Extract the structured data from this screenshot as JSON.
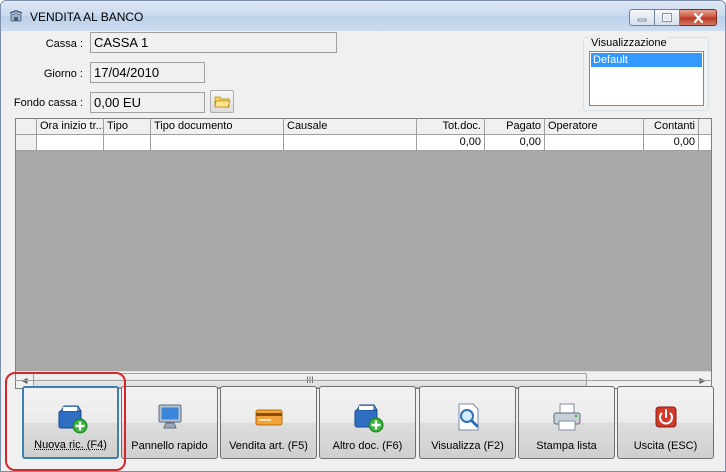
{
  "window": {
    "title": "VENDITA AL BANCO"
  },
  "form": {
    "cassa_label": "Cassa :",
    "cassa_value": "CASSA 1",
    "giorno_label": "Giorno :",
    "giorno_value": "17/04/2010",
    "fondo_label": "Fondo cassa :",
    "fondo_value": "0,00 EU"
  },
  "visualizzazione": {
    "label": "Visualizzazione",
    "selected": "Default"
  },
  "grid": {
    "columns": [
      "Ora inizio tr...",
      "Tipo",
      "Tipo documento",
      "Causale",
      "Tot.doc.",
      "Pagato",
      "Operatore",
      "Contanti"
    ],
    "row": [
      "",
      "",
      "",
      "",
      "0,00",
      "0,00",
      "",
      "0,00"
    ],
    "scroll_grip": "III"
  },
  "buttons": [
    {
      "label": "Nuova ric. (F4)",
      "icon": "new-receipt-icon"
    },
    {
      "label": "Pannello rapido",
      "icon": "monitor-icon"
    },
    {
      "label": "Vendita art. (F5)",
      "icon": "card-icon"
    },
    {
      "label": "Altro doc. (F6)",
      "icon": "new-document-icon"
    },
    {
      "label": "Visualizza (F2)",
      "icon": "magnify-icon"
    },
    {
      "label": "Stampa lista",
      "icon": "printer-icon"
    },
    {
      "label": "Uscita (ESC)",
      "icon": "power-icon"
    }
  ],
  "colors": {
    "accent": "#3399ff",
    "highlight": "#d9262c",
    "grid_bg": "#a8a8a8"
  }
}
